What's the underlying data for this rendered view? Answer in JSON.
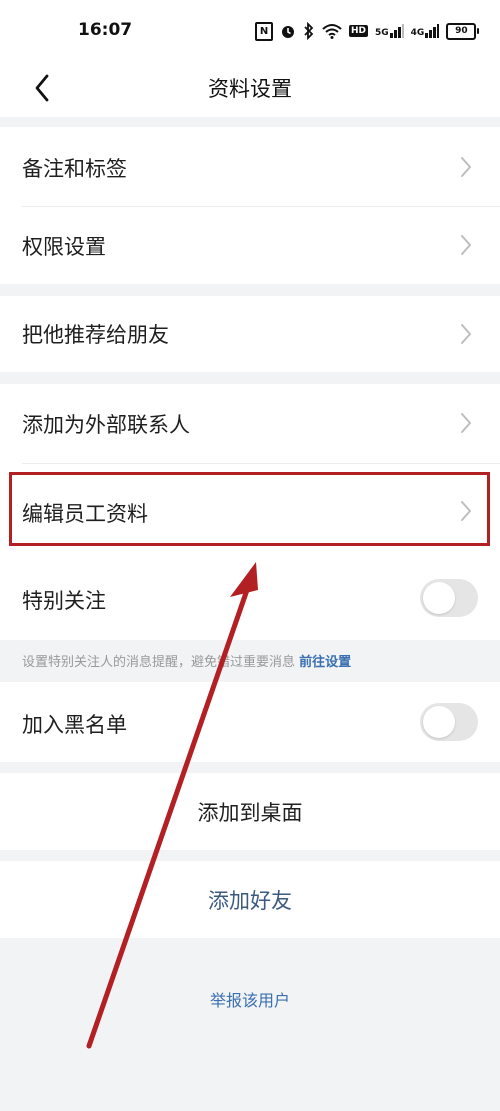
{
  "status_bar": {
    "time": "16:07",
    "nfc_icon": "N",
    "hd_label": "HD",
    "signal1_label": "5G",
    "signal2_label": "4G",
    "battery": "90"
  },
  "nav": {
    "title": "资料设置"
  },
  "menu": {
    "notes_tags": "备注和标签",
    "permissions": "权限设置",
    "recommend": "把他推荐给朋友",
    "add_external": "添加为外部联系人",
    "edit_employee": "编辑员工资料"
  },
  "special_follow": {
    "label": "特别关注",
    "enabled": false,
    "hint_text": "设置特别关注人的消息提醒，避免错过重要消息",
    "hint_link": "前往设置"
  },
  "blacklist": {
    "label": "加入黑名单",
    "enabled": false
  },
  "actions": {
    "add_to_desktop": "添加到桌面",
    "add_friend": "添加好友",
    "report_user": "举报该用户"
  },
  "colors": {
    "background": "#F2F3F5",
    "link": "#3A6FB0",
    "add_friend_text": "#3D5A80",
    "annotation": "#B32024",
    "chevron": "#BDBDBD",
    "toggle_off": "#E5E5E5"
  }
}
